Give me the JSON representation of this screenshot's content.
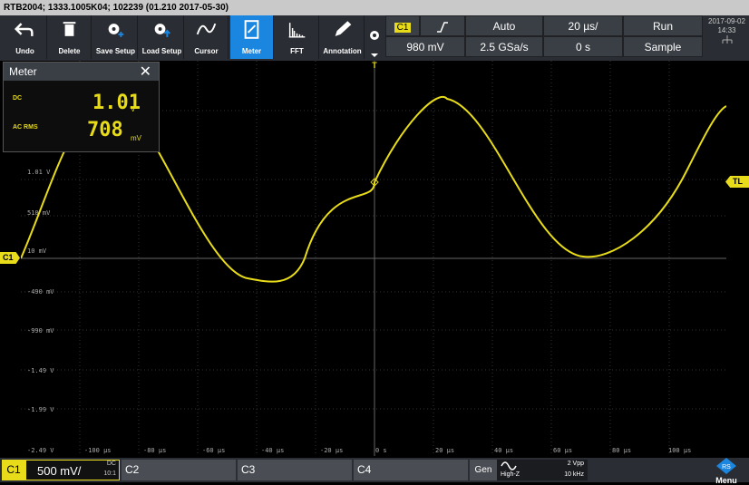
{
  "title": "RTB2004; 1333.1005K04; 102239 (01.210 2017-05-30)",
  "toolbar": {
    "undo": "Undo",
    "delete": "Delete",
    "save_setup": "Save Setup",
    "load_setup": "Load Setup",
    "cursor": "Cursor",
    "meter": "Meter",
    "fft": "FFT",
    "annotation": "Annotation"
  },
  "trigger": {
    "channel": "C1",
    "mode": "Auto",
    "level": "980 mV",
    "sample_rate": "2.5 GSa/s",
    "timebase": "20 µs/",
    "position": "0 s",
    "run_state": "Run",
    "acq_mode": "Sample"
  },
  "datetime": {
    "date": "2017-09-02",
    "time": "14:33"
  },
  "meter": {
    "title": "Meter",
    "dc_label": "DC",
    "dc_value": "1.01",
    "dc_unit": "V",
    "acrms_label": "AC RMS",
    "acrms_value": "708",
    "acrms_unit": "mV"
  },
  "markers": {
    "trigger_level": "TL",
    "channel": "C1",
    "trigger_pos": "T"
  },
  "y_labels": [
    "1.01 V",
    "510 mV",
    "10 mV",
    "-490 mV",
    "-990 mV",
    "-1.49 V",
    "-1.99 V",
    "-2.49 V"
  ],
  "x_labels": [
    "-100 µs",
    "-80 µs",
    "-60 µs",
    "-40 µs",
    "-20 µs",
    "0 s",
    "20 µs",
    "40 µs",
    "60 µs",
    "80 µs",
    "100 µs"
  ],
  "bottom": {
    "c1": "C1",
    "c1_scale": "500 mV/",
    "c1_coupling": "DC",
    "c1_probe": "10:1",
    "c2": "C2",
    "c3": "C3",
    "c4": "C4",
    "gen": "Gen",
    "gen_load": "High-Z",
    "gen_amp": "2 Vpp",
    "gen_freq": "10 kHz",
    "menu": "Menu"
  },
  "colors": {
    "trace": "#e8dc1a",
    "active": "#1b86e0",
    "panel": "#2a2d33"
  }
}
